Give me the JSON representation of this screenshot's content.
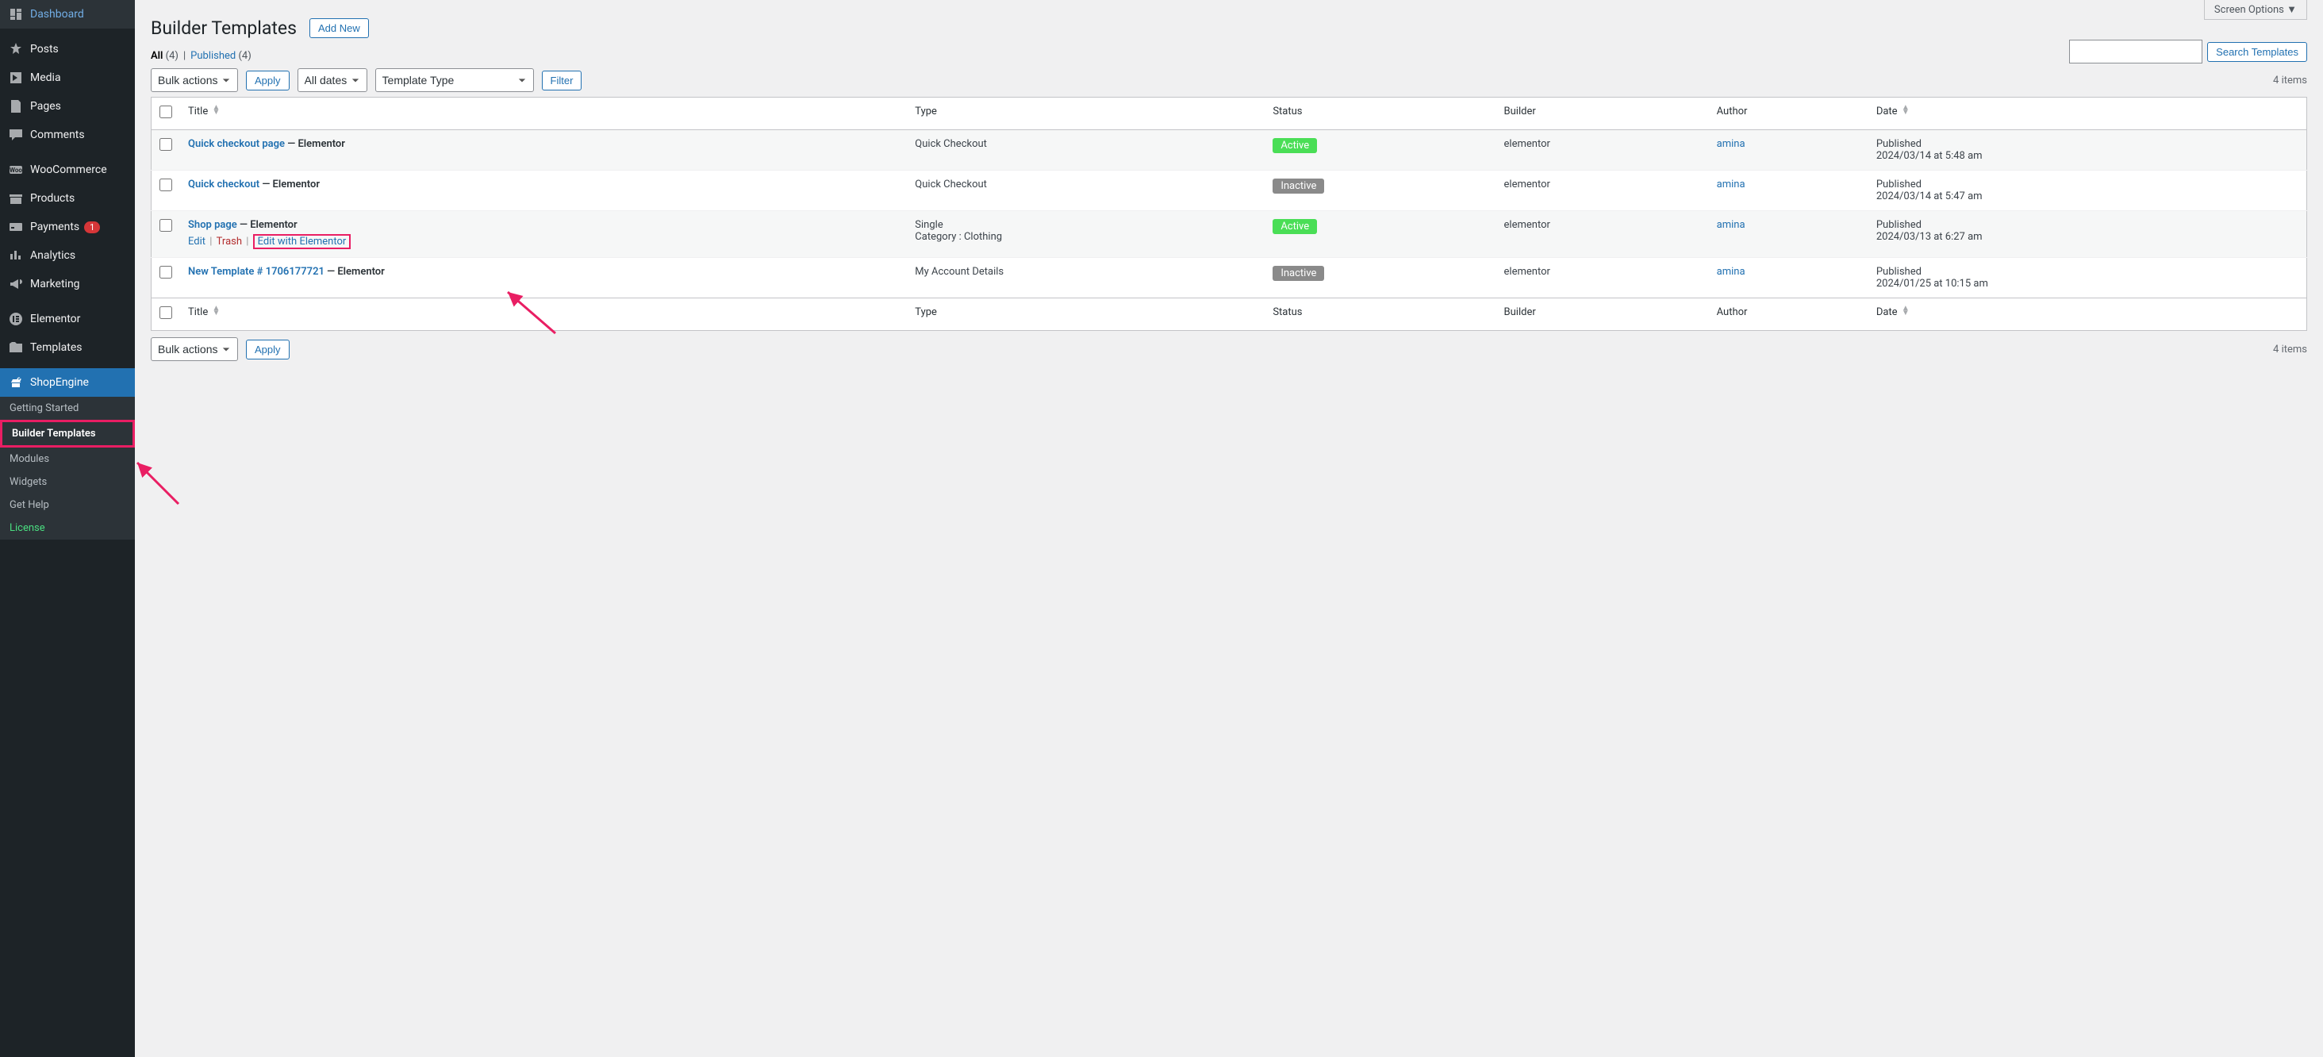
{
  "screen_options_label": "Screen Options",
  "page_title": "Builder Templates",
  "add_new_label": "Add New",
  "search_button": "Search Templates",
  "views": {
    "all_label": "All",
    "all_count": "(4)",
    "published_label": "Published",
    "published_count": "(4)",
    "separator": " | "
  },
  "filters": {
    "bulk_actions": "Bulk actions",
    "apply": "Apply",
    "all_dates": "All dates",
    "template_type": "Template Type",
    "filter": "Filter",
    "items_count": "4 items"
  },
  "columns": {
    "title": "Title",
    "type": "Type",
    "status": "Status",
    "builder": "Builder",
    "author": "Author",
    "date": "Date"
  },
  "rows": [
    {
      "title": "Quick checkout page",
      "suffix": " — Elementor",
      "type": "Quick Checkout",
      "type_extra": "",
      "status": "Active",
      "status_class": "status-active",
      "builder": "elementor",
      "author": "amina",
      "date_label": "Published",
      "date_value": "2024/03/14 at 5:48 am",
      "show_actions": false
    },
    {
      "title": "Quick checkout",
      "suffix": " — Elementor",
      "type": "Quick Checkout",
      "type_extra": "",
      "status": "Inactive",
      "status_class": "status-inactive",
      "builder": "elementor",
      "author": "amina",
      "date_label": "Published",
      "date_value": "2024/03/14 at 5:47 am",
      "show_actions": false
    },
    {
      "title": "Shop page",
      "suffix": " — Elementor",
      "type": "Single",
      "type_extra": "Category : Clothing",
      "status": "Active",
      "status_class": "status-active",
      "builder": "elementor",
      "author": "amina",
      "date_label": "Published",
      "date_value": "2024/03/13 at 6:27 am",
      "show_actions": true
    },
    {
      "title": "New Template # 1706177721",
      "suffix": " — Elementor",
      "type": "My Account Details",
      "type_extra": "",
      "status": "Inactive",
      "status_class": "status-inactive",
      "builder": "elementor",
      "author": "amina",
      "date_label": "Published",
      "date_value": "2024/01/25 at 10:15 am",
      "show_actions": false
    }
  ],
  "row_actions": {
    "edit": "Edit",
    "trash": "Trash",
    "edit_with_elementor": "Edit with Elementor"
  },
  "sidebar": {
    "items": [
      {
        "label": "Dashboard",
        "icon": "dashboard"
      },
      {
        "label": "Posts",
        "icon": "pin"
      },
      {
        "label": "Media",
        "icon": "media"
      },
      {
        "label": "Pages",
        "icon": "page"
      },
      {
        "label": "Comments",
        "icon": "comment"
      },
      {
        "label": "WooCommerce",
        "icon": "woo"
      },
      {
        "label": "Products",
        "icon": "products"
      },
      {
        "label": "Payments",
        "icon": "payments",
        "badge": "1"
      },
      {
        "label": "Analytics",
        "icon": "analytics"
      },
      {
        "label": "Marketing",
        "icon": "marketing"
      },
      {
        "label": "Elementor",
        "icon": "elementor"
      },
      {
        "label": "Templates",
        "icon": "templates"
      },
      {
        "label": "ShopEngine",
        "icon": "shopengine",
        "active": true
      }
    ],
    "submenu": [
      {
        "label": "Getting Started"
      },
      {
        "label": "Builder Templates",
        "current": true,
        "highlight": true
      },
      {
        "label": "Modules"
      },
      {
        "label": "Widgets"
      },
      {
        "label": "Get Help"
      },
      {
        "label": "License",
        "license": true
      }
    ]
  }
}
